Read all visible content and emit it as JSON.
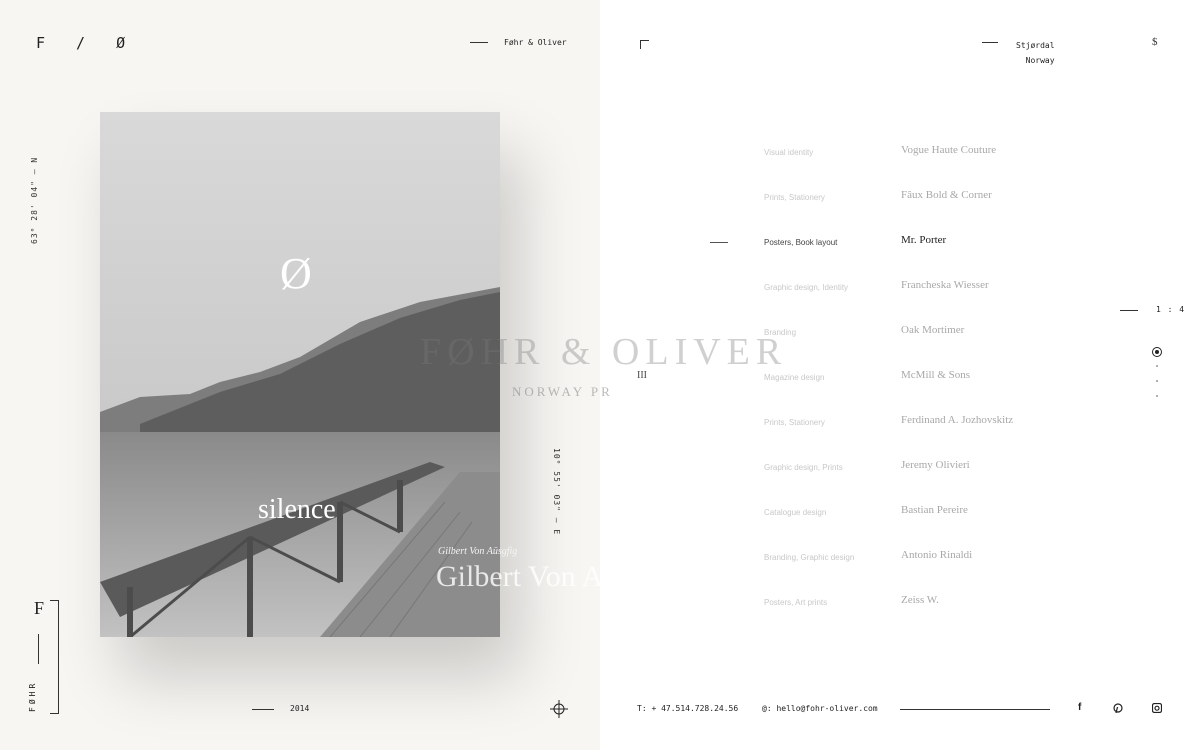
{
  "logo": "F / Ø",
  "studio_name": "Føhr & Oliver",
  "coords_left": "63° 28' 04\" — N",
  "coords_right": "10° 55' 03\" — E",
  "photo": {
    "mark": "Ø",
    "word": "silence",
    "author_small": "Gilbert Von Aüsgfig",
    "author_large": "Gilbert Von Aü"
  },
  "brand_title": "FØHR & OLIVER",
  "brand_subtitle": "NORWAY PR",
  "roman_numeral": "III",
  "footer_left": {
    "brand_vertical": "FØHR",
    "year": "2014"
  },
  "location": {
    "city": "Stjørdal",
    "country": "Norway"
  },
  "projects": [
    {
      "category": "Visual identity",
      "name": "Vogue Haute Couture",
      "active": false
    },
    {
      "category": "Prints, Stationery",
      "name": "Fâux Bold & Corner",
      "active": false
    },
    {
      "category": "Posters, Book layout",
      "name": "Mr. Porter",
      "active": true
    },
    {
      "category": "Graphic design, Identity",
      "name": "Francheska Wiesser",
      "active": false
    },
    {
      "category": "Branding",
      "name": "Oak Mortimer",
      "active": false
    },
    {
      "category": "Magazine design",
      "name": "McMill & Sons",
      "active": false
    },
    {
      "category": "Prints, Stationery",
      "name": "Ferdinand A. Jozhovskitz",
      "active": false
    },
    {
      "category": "Graphic design, Prints",
      "name": "Jeremy Olivieri",
      "active": false
    },
    {
      "category": "Catalogue design",
      "name": "Bastian Pereire",
      "active": false
    },
    {
      "category": "Branding, Graphic design",
      "name": "Antonio Rinaldi",
      "active": false
    },
    {
      "category": "Posters, Art prints",
      "name": "Zeiss W.",
      "active": false
    }
  ],
  "pager": {
    "counter": "1 : 4"
  },
  "contact": {
    "phone": "T: + 47.514.728.24.56",
    "email": "@: hello@fohr-oliver.com"
  },
  "social": [
    "f",
    "p",
    "ig"
  ]
}
